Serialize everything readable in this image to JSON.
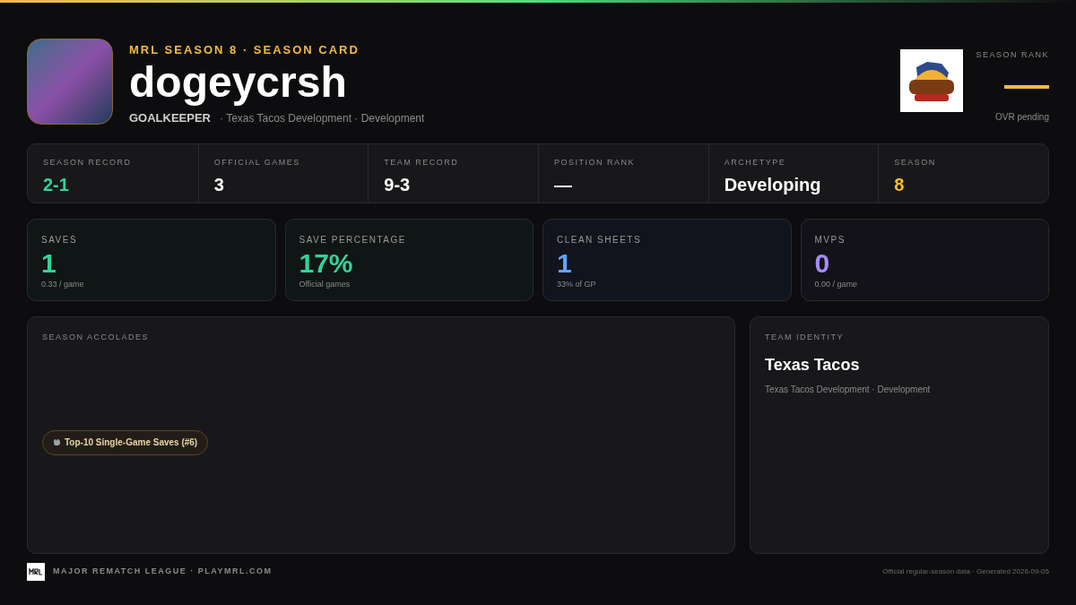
{
  "header": {
    "eyebrow": "MRL SEASON 8 · SEASON CARD",
    "player_name": "dogeycrsh",
    "position": "GOALKEEPER",
    "team_line": "· Texas Tacos Development · Development",
    "rank_label": "SEASON RANK",
    "rank_note": "OVR pending"
  },
  "summary": [
    {
      "label": "SEASON RECORD",
      "value": "2-1",
      "color": "#34d399"
    },
    {
      "label": "OFFICIAL GAMES",
      "value": "3",
      "color": "#ffffff"
    },
    {
      "label": "TEAM RECORD",
      "value": "9-3",
      "color": "#ffffff"
    },
    {
      "label": "POSITION RANK",
      "value": "—",
      "color": "#ffffff"
    },
    {
      "label": "ARCHETYPE",
      "value": "Developing",
      "color": "#ffffff"
    },
    {
      "label": "SEASON",
      "value": "8",
      "color": "#fbbf24"
    }
  ],
  "metrics": [
    {
      "label": "SAVES",
      "value": "1",
      "note": "0.33 / game",
      "color": "#34d399"
    },
    {
      "label": "SAVE PERCENTAGE",
      "value": "17%",
      "note": "Official games",
      "color": "#34d399"
    },
    {
      "label": "CLEAN SHEETS",
      "value": "1",
      "note": "33% of GP",
      "color": "#60a5fa"
    },
    {
      "label": "MVPS",
      "value": "0",
      "note": "0.00 / game",
      "color": "#a78bfa"
    }
  ],
  "accolades": {
    "title": "SEASON ACCOLADES",
    "items": [
      {
        "label": "Top-10 Single-Game Saves (#6)"
      }
    ]
  },
  "team_identity": {
    "title": "TEAM IDENTITY",
    "name": "Texas Tacos",
    "subtitle": "Texas Tacos Development · Development"
  },
  "footer": {
    "league": "MAJOR REMATCH LEAGUE · PLAYMRL.COM",
    "note": "Official regular-season data · Generated 2026-09-05"
  }
}
